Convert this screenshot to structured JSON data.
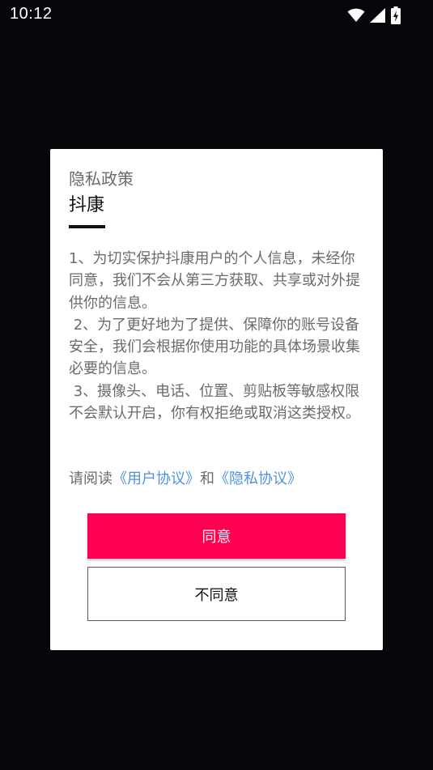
{
  "status_bar": {
    "time": "10:12",
    "icons": [
      "wifi-icon",
      "cell-signal-icon",
      "battery-charging-icon"
    ]
  },
  "dialog": {
    "title": "隐私政策",
    "app_name": "抖康",
    "paragraphs": [
      "1、为切实保护抖康用户的个人信息，未经你同意，我们不会从第三方获取、共享或对外提供你的信息。",
      " 2、为了更好地为了提供、保障你的账号设备安全，我们会根据你使用功能的具体场景收集必要的信息。",
      " 3、摄像头、电话、位置、剪贴板等敏感权限不会默认开启，你有权拒绝或取消这类授权。"
    ],
    "read_prefix": "请阅读",
    "user_agreement_link": "《用户协议》",
    "and_text": "和",
    "privacy_agreement_link": "《隐私协议》",
    "agree_label": "同意",
    "disagree_label": "不同意"
  },
  "colors": {
    "background": "#08060b",
    "dialog": "#ffffff",
    "accent": "#ff0052",
    "link": "#4f93df",
    "body_text": "#6b6b6b"
  }
}
